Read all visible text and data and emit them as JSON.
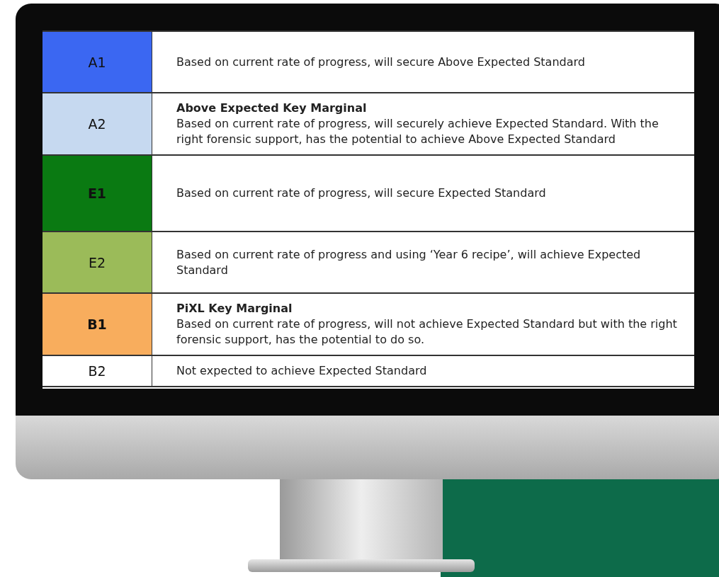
{
  "table": {
    "rows": [
      {
        "grade": "A1",
        "color": "#3b67f2",
        "bold": false,
        "text": "Based on current rate of progress, will secure Above Expected Standard"
      },
      {
        "grade": "A2",
        "color": "#c6d9f0",
        "bold": false,
        "heading": "Above Expected Key Marginal",
        "text": "Based on current rate of progress, will securely achieve Expected Standard.  With the right forensic support, has the potential to achieve Above Expected Standard"
      },
      {
        "grade": "E1",
        "color": "#0a7a12",
        "bold": true,
        "text": "Based on current rate of progress, will secure Expected Standard"
      },
      {
        "grade": "E2",
        "color": "#9bbb59",
        "bold": false,
        "text": "Based on current rate of progress and using ‘Year 6 recipe’, will achieve Expected Standard"
      },
      {
        "grade": "B1",
        "color": "#f8ad5d",
        "bold": true,
        "heading": "PiXL Key Marginal",
        "text": "Based on current rate of progress, will not achieve Expected Standard but with the right forensic support, has the potential to do so."
      },
      {
        "grade": "B2",
        "color": "#ffffff",
        "bold": false,
        "text": "Not expected to achieve Expected Standard"
      }
    ]
  }
}
